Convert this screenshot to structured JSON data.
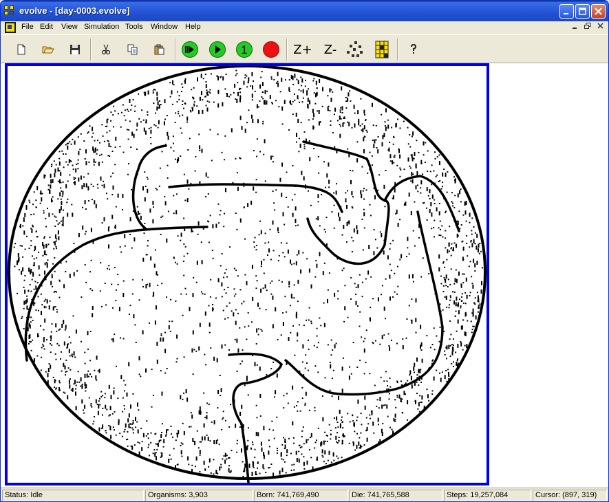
{
  "window": {
    "title": "evolve - [day-0003.evolve]"
  },
  "menubar": {
    "items": [
      "File",
      "Edit",
      "View",
      "Simulation",
      "Tools",
      "Window",
      "Help"
    ]
  },
  "toolbar": {
    "zoom_in_label": "Z+",
    "zoom_out_label": "Z-",
    "step_one_label": "1"
  },
  "status": {
    "state": "Status: Idle",
    "organisms": "Organisms: 3,903",
    "born": "Born: 741,769,490",
    "die": "Die: 741,765,588",
    "steps": "Steps: 19,257,084",
    "cursor": "Cursor: (897, 319)"
  },
  "colors": {
    "titlebar": "#2A5CDB",
    "canvas_border": "#0000E6",
    "run_green": "#22CC22",
    "stop_red": "#EE1111"
  }
}
